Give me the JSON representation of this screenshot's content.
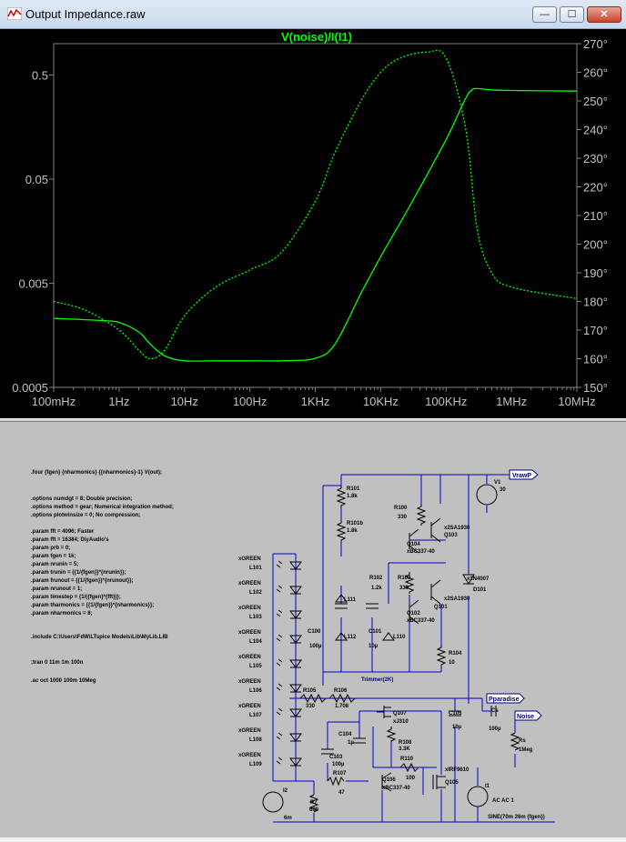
{
  "window": {
    "title": "Output Impedance.raw",
    "buttons": {
      "minimize": "—",
      "maximize": "☐",
      "close": "✕"
    }
  },
  "plot": {
    "trace_label": "V(noise)/I(I1)",
    "colors": {
      "trace": "#00ff00",
      "background": "#000000",
      "axis": "#808080",
      "text": "#c0c0c0"
    },
    "x_ticks": [
      "100mHz",
      "1Hz",
      "10Hz",
      "100Hz",
      "1KHz",
      "10KHz",
      "100KHz",
      "1MHz",
      "10MHz"
    ],
    "y_left_ticks": [
      "0.5",
      "0.05",
      "0.005",
      "0.0005"
    ],
    "y_right_ticks": [
      "270°",
      "260°",
      "250°",
      "240°",
      "230°",
      "220°",
      "210°",
      "200°",
      "190°",
      "180°",
      "170°",
      "160°",
      "150°"
    ],
    "chart_data": {
      "type": "line",
      "title": "V(noise)/I(I1)",
      "xscale": "log",
      "xlim": [
        0.1,
        10000000
      ],
      "left_axis": {
        "scale": "log",
        "ylim": [
          0.0005,
          1
        ]
      },
      "right_axis": {
        "ylim": [
          150,
          270
        ]
      },
      "series": [
        {
          "line": "solid",
          "axis": "left",
          "x": [
            0.1,
            0.5,
            1,
            2,
            3,
            5,
            10,
            30,
            100,
            300,
            1000,
            2000,
            5000,
            10000,
            30000,
            100000,
            200000,
            250000,
            300000,
            500000,
            1000000,
            10000000
          ],
          "y": [
            0.0023,
            0.0022,
            0.0021,
            0.0017,
            0.0013,
            0.001,
            0.0009,
            0.0009,
            0.0009,
            0.0009,
            0.00095,
            0.0013,
            0.004,
            0.009,
            0.03,
            0.12,
            0.3,
            0.36,
            0.37,
            0.36,
            0.355,
            0.35
          ]
        },
        {
          "line": "dashed",
          "axis": "right",
          "x": [
            0.1,
            0.3,
            1,
            2,
            3,
            5,
            10,
            30,
            100,
            300,
            1000,
            2000,
            5000,
            10000,
            20000,
            50000,
            100000,
            200000,
            300000,
            500000,
            1000000,
            10000000
          ],
          "y": [
            180,
            177,
            170,
            163,
            160,
            163,
            175,
            185,
            191,
            197,
            215,
            232,
            250,
            260,
            265,
            267,
            265,
            240,
            205,
            190,
            185,
            181
          ]
        }
      ]
    }
  },
  "schematic": {
    "colors": {
      "background": "#c0c0c0",
      "wire": "#0000cc",
      "part": "#000000",
      "label": "#000080"
    },
    "directives": [
      ".four {fgen} {nharmonics} {{nharmonics}-1} V(out);",
      ".options numdgt = 8; Double precision;",
      ".options method = gear; Numerical integration method;",
      ".options plotwinsize = 0; No compression;",
      ".param fft = 4096; Faster",
      ".param fft = 16384; DiyAudio's",
      ".param prb = 0;",
      ".param fgen = 1k;",
      ".param nrunin = 5;",
      ".param trunin = {{1/{fgen}}*{nrunin}};",
      ".param frunout = {{1/{fgen}}*{nrunout}};",
      ".param nrunout = 1;",
      ".param timestep = {1/({fgen}*{fft})};",
      ".param tharmonics = {{1/{fgen}}*{nharmonics}};",
      ".param nharmonics = 8;",
      ".include C:\\Users\\FdW\\LTspice Models\\Lib\\MyLib.LIB",
      ";tran 0 11m 1m 100n",
      ".ac oct 1000 100m 10Meg"
    ],
    "leds": [
      "L101",
      "L102",
      "L103",
      "L104",
      "L105",
      "L106",
      "L107",
      "L108",
      "L109"
    ],
    "led_model": "xGREEN",
    "labels": {
      "vrawp": "VrawP",
      "pparadise": "Pparadise",
      "noise": "Noise",
      "r101": "R101",
      "r101_val": "1.8k",
      "r101b": "R101b",
      "r101b_val": "1.8k",
      "r100": "R100",
      "r100_val": "330",
      "q103": "Q103",
      "q103_model": "x2SA1930",
      "q104": "Q104",
      "q104_model": "xBC337-40",
      "r102": "R102",
      "r102_val": "1.2k",
      "r103": "R103",
      "r103_val": "330",
      "q101": "Q101",
      "q101_model": "x2SA1930",
      "q102": "Q102",
      "q102_model": "xBC337-40",
      "d101": "D101",
      "d101_model": "x1N4007",
      "v1": "V1",
      "v1_val": "30",
      "l111": "L111",
      "l112": "L112",
      "l110": "L110",
      "c100": "C100",
      "c100_val": "100µ",
      "c101": "C101",
      "c101_val": "10µ",
      "r104": "R104",
      "r104_val": "10",
      "trimmer": "Trimmer(2K)",
      "r105": "R105",
      "r105_val": "330",
      "r106": "R106",
      "r106_val": "1.708",
      "q107": "Q107",
      "q107_model": "xJ310",
      "c104": "C104",
      "c104_val": "1µ",
      "r108": "R108",
      "r108_val": "3.3K",
      "r110": "R110",
      "r110_val": "100",
      "c103": "C103",
      "c103_val": "100µ",
      "r107": "R107",
      "r107_val": "47",
      "q106": "Q106",
      "q106_model": "xBC337-40",
      "q105": "Q105",
      "q105_model": "xIRF9610",
      "c105": "C105",
      "c105_val": "10µ",
      "cs": "Cs",
      "cs_val": "100µ",
      "rs": "Rs",
      "rs_val": "1Meg",
      "r7": "R7",
      "r7_val": "680",
      "i2": "I2",
      "i2_val": "6m",
      "i1": "I1",
      "i1_ac": "AC AC 1",
      "i1_sine": "SINE(70m 26m {fgen})"
    }
  }
}
